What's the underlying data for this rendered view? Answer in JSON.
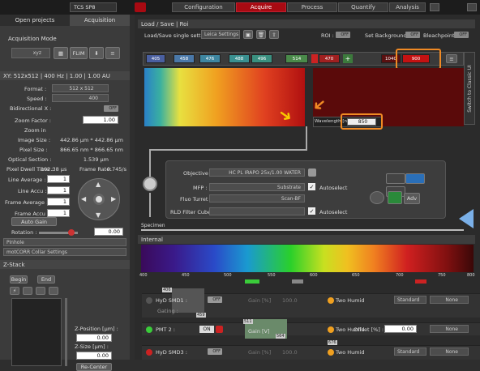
{
  "topbar": {
    "microscope": "TCS SP8",
    "workflow": [
      "Configuration",
      "Acquire",
      "Process",
      "Quantify",
      "Analysis"
    ],
    "active": "Acquire"
  },
  "left": {
    "tabs": [
      "Open projects",
      "Acquisition"
    ],
    "acq_mode_label": "Acquisition Mode",
    "acq_mode": "xyz",
    "mode_buttons": [
      "FLIM"
    ],
    "xy_header": "XY: 512x512 | 400 Hz | 1.00 | 1.00 AU",
    "format_label": "Format :",
    "format": "512 x 512",
    "speed_label": "Speed :",
    "speed": "400",
    "bidir_label": "Bidirectional X :",
    "bidir": "OFF",
    "zoom_factor_label": "Zoom Factor :",
    "zoom_factor": "1.00",
    "zoom_in_label": "Zoom in",
    "image_size_label": "Image Size :",
    "image_size": "442.86 µm * 442.86 µm",
    "pixel_size_label": "Pixel Size :",
    "pixel_size": "866.65 nm * 866.65 nm",
    "optical_section_label": "Optical Section :",
    "optical_section": "1.539 µm",
    "pixel_dwell_label": "Pixel Dwell Time :",
    "pixel_dwell": "102.38 µs",
    "frame_rate_label": "Frame Rate:",
    "frame_rate": "0.745/s",
    "line_average_label": "Line Average :",
    "line_average": "1",
    "line_accu_label": "Line Accu :",
    "line_accu": "1",
    "frame_average_label": "Frame Average :",
    "frame_average": "1",
    "frame_accu_label": "Frame Accu :",
    "frame_accu": "1",
    "auto_gain": "Auto Gain",
    "rotation_label": "Rotation :",
    "rotation": "0.00",
    "pinhole": "Pinhole",
    "motcorr": "motCORR Collar Settings",
    "zstack_header": "Z-Stack",
    "begin": "Begin",
    "end": "End",
    "zpos_label": "Z-Position [µm] :",
    "zpos": "0.00",
    "zsize_label": "Z-Size [µm] :",
    "zsize": "0.00",
    "recenter": "Re-Center"
  },
  "main": {
    "lsr_header": "Load / Save | Roi",
    "load_save_label": "Load/Save single setting :",
    "load_save_value": "Leica Settings",
    "roi_label": "ROI :",
    "roi": "OFF",
    "set_bg_label": "Set Background :",
    "set_bg": "OFF",
    "bleach_label": "Bleachpoint :",
    "bleach": "OFF",
    "lasers": [
      "405",
      "458",
      "476",
      "488",
      "496",
      "514",
      "470",
      "1040",
      "900"
    ],
    "switch_label": "Switch to Classic UI",
    "wavelength_label": "Wavelength [nm]",
    "wavelength": "850",
    "objective_label": "Objective :",
    "objective": "HC PL IRAPO 25x/1.00 WATER",
    "mfp_label": "MFP :",
    "mfp": "Substrate",
    "autoselect": "Autoselect",
    "fluo_label": "Fluo Turret :",
    "fluo": "Scan-BF",
    "rld_label": "RLD Filter Cube :",
    "rld": "",
    "adv": "Adv",
    "specimen": "Specimen",
    "internal_header": "Internal",
    "spectrum_ticks": [
      "400",
      "450",
      "500",
      "550",
      "600",
      "650",
      "700",
      "750",
      "800"
    ],
    "det_markers": [
      "406",
      "459"
    ],
    "detectors": [
      {
        "name": "HyD SMD1 :",
        "state": "OFF",
        "gain_label": "Gain [%]",
        "gain": "100.0",
        "dye": "Two Humid",
        "mode": "Standard",
        "seq": "None"
      },
      {
        "name": "PMT 2 :",
        "state": "ON",
        "gain_label": "Gain [V]",
        "gain": "",
        "offset_label": "Offset [%] :",
        "offset": "0.00",
        "dye": "Two Humid",
        "mode": "",
        "seq": "None"
      },
      {
        "name": "HyD SMD3 :",
        "state": "OFF",
        "gain_label": "Gain [%]",
        "gain": "100.0",
        "dye": "Two Humid",
        "mode": "Standard",
        "seq": "None"
      }
    ],
    "gating_label": "Gating :",
    "pmt_markers": [
      "511",
      "564"
    ],
    "hyd3_marker": "676"
  },
  "colors": {
    "accent": "#a80a12",
    "highlight": "#f08a24"
  }
}
